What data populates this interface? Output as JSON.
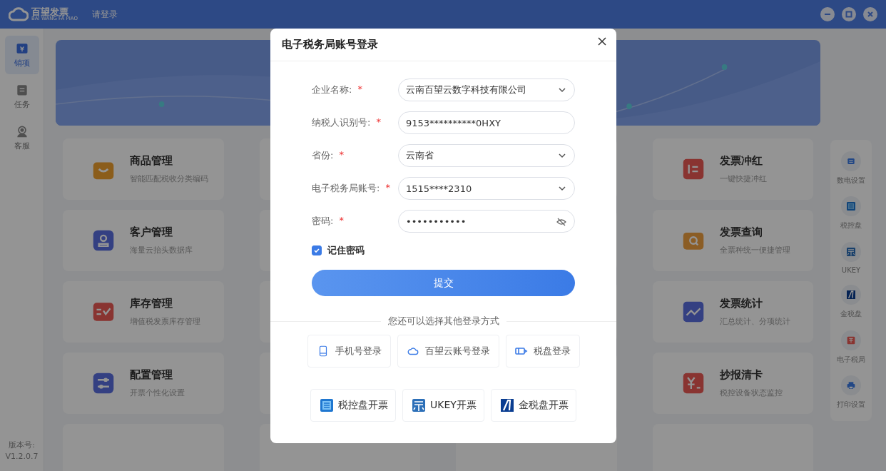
{
  "titlebar": {
    "app_name": "百望发票",
    "app_subtitle": "BAI WANG FA PIAO",
    "login": "请登录"
  },
  "sidebar": {
    "items": [
      {
        "label": "销项",
        "selected": true,
        "kind": "ticket"
      },
      {
        "label": "任务",
        "selected": false,
        "kind": "clipboard"
      },
      {
        "label": "客服",
        "selected": false,
        "kind": "agent"
      }
    ],
    "version_label": "版本号:",
    "version": "V1.2.0.7"
  },
  "cards_left": [
    {
      "title": "商品管理",
      "subtitle": "智能匹配税收分类编码",
      "kind": "bag"
    },
    {
      "title": "客户管理",
      "subtitle": "海量云抬头数据库",
      "kind": "person"
    },
    {
      "title": "库存管理",
      "subtitle": "增值税发票库存管理",
      "kind": "stock"
    },
    {
      "title": "配置管理",
      "subtitle": "开票个性化设置",
      "kind": "sliders"
    }
  ],
  "cards_right": [
    {
      "title": "发票冲红",
      "subtitle": "一键快捷冲红",
      "kind": "list"
    },
    {
      "title": "发票查询",
      "subtitle": "全票种统一便捷管理",
      "kind": "search"
    },
    {
      "title": "发票统计",
      "subtitle": "汇总统计、分项统计",
      "kind": "chart"
    },
    {
      "title": "抄报清卡",
      "subtitle": "税控设备状态监控",
      "kind": "yen"
    }
  ],
  "right_toolbar": [
    {
      "label": "数电设置",
      "kind": "digital"
    },
    {
      "label": "税控盘",
      "kind": "disk"
    },
    {
      "label": "UKEY",
      "kind": "ukey"
    },
    {
      "label": "金税盘",
      "kind": "golden"
    },
    {
      "label": "电子税局",
      "kind": "tax"
    },
    {
      "label": "打印设置",
      "kind": "printer"
    }
  ],
  "dialog": {
    "title": "电子税务局账号登录",
    "fields": [
      {
        "label": "企业名称:",
        "required_mark": "*",
        "value": "云南百望云数字科技有限公司",
        "kind": "select"
      },
      {
        "label": "纳税人识别号:",
        "required_mark": "*",
        "value": "9153**********0HXY",
        "kind": "text"
      },
      {
        "label": "省份:",
        "required_mark": "*",
        "value": "云南省",
        "kind": "select"
      },
      {
        "label": "电子税务局账号:",
        "required_mark": "*",
        "value": "1515****2310",
        "kind": "select"
      },
      {
        "label": "密码:",
        "required_mark": "*",
        "value": "•••••••••••",
        "kind": "password"
      }
    ],
    "remember": {
      "label": "记住密码",
      "checked": true
    },
    "submit": "提交",
    "alt_title": "您还可以选择其他登录方式",
    "alt_methods": [
      {
        "label": "手机号登录",
        "kind": "phone"
      },
      {
        "label": "百望云账号登录",
        "kind": "cloud"
      },
      {
        "label": "税盘登录",
        "kind": "disk"
      }
    ],
    "invoice_methods": [
      {
        "label": "税控盘开票",
        "kind": "disk"
      },
      {
        "label": "UKEY开票",
        "kind": "ukey"
      },
      {
        "label": "金税盘开票",
        "kind": "golden"
      }
    ]
  }
}
